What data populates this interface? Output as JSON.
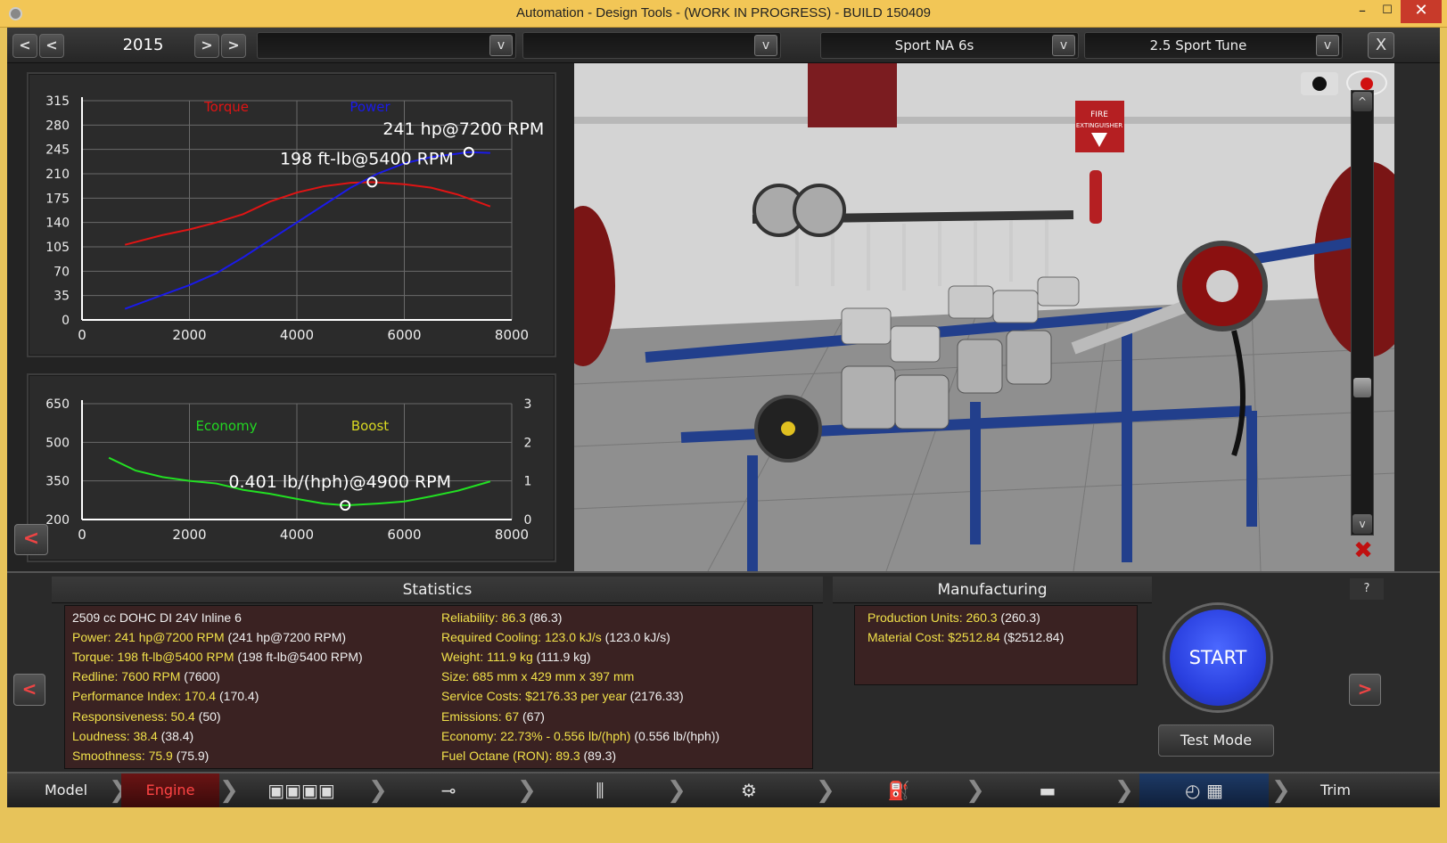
{
  "window": {
    "title": "Automation - Design Tools - (WORK IN PROGRESS) - BUILD 150409",
    "min": "–",
    "max": "☐",
    "close": "✕"
  },
  "toolbar": {
    "year": "2015",
    "prev_fast": "<",
    "prev": "<",
    "next": ">",
    "next_fast": ">",
    "dropdown1": "",
    "dropdown2": "",
    "dropdown3": "Sport NA 6s",
    "dropdown4": "2.5 Sport Tune",
    "arrow": "v",
    "close": "X"
  },
  "charts": {
    "power_torque": {
      "type": "line",
      "x_ticks": [
        "0",
        "2000",
        "4000",
        "6000",
        "8000"
      ],
      "y_ticks": [
        "315",
        "280",
        "245",
        "210",
        "175",
        "140",
        "105",
        "70",
        "35",
        "0"
      ],
      "xlim": [
        0,
        8000
      ],
      "ylim": [
        0,
        315
      ],
      "legend": [
        "Torque",
        "Power"
      ],
      "series": [
        {
          "name": "Torque",
          "color": "#e01414",
          "x": [
            800,
            1500,
            2000,
            2500,
            3000,
            3500,
            4000,
            4500,
            5000,
            5400,
            6000,
            6500,
            7000,
            7600
          ],
          "y": [
            108,
            122,
            130,
            140,
            152,
            170,
            183,
            192,
            197,
            198,
            195,
            190,
            180,
            163
          ]
        },
        {
          "name": "Power",
          "color": "#1a1ae8",
          "x": [
            800,
            1500,
            2000,
            2500,
            3000,
            3500,
            4000,
            4500,
            5000,
            5500,
            6000,
            6500,
            7200,
            7600
          ],
          "y": [
            16,
            36,
            50,
            67,
            90,
            115,
            140,
            165,
            190,
            210,
            225,
            234,
            241,
            240
          ]
        }
      ],
      "annotations": [
        {
          "text": "241 hp@7200 RPM",
          "x": 7200,
          "y": 241
        },
        {
          "text": "198 ft-lb@5400 RPM",
          "x": 5400,
          "y": 198
        }
      ]
    },
    "economy": {
      "type": "line",
      "x_ticks": [
        "0",
        "2000",
        "4000",
        "6000",
        "8000"
      ],
      "y_ticks": [
        "650",
        "500",
        "350",
        "200"
      ],
      "y2_ticks": [
        "3",
        "2",
        "1",
        "0"
      ],
      "xlim": [
        0,
        8000
      ],
      "ylim": [
        200,
        650
      ],
      "legend": [
        "Economy",
        "Boost"
      ],
      "legend_colors": [
        "#22d822",
        "#d8d822"
      ],
      "series": [
        {
          "name": "Economy",
          "color": "#22e022",
          "x": [
            500,
            1000,
            1500,
            2000,
            2500,
            3000,
            3500,
            4000,
            4500,
            4900,
            5500,
            6000,
            6500,
            7000,
            7600
          ],
          "y": [
            440,
            390,
            365,
            350,
            340,
            315,
            300,
            280,
            262,
            255,
            262,
            270,
            290,
            312,
            348
          ]
        }
      ],
      "annotations": [
        {
          "text": "0.401 lb/(hph)@4900 RPM",
          "x": 4900,
          "y": 255
        }
      ]
    }
  },
  "collapse_label": "<",
  "viewport": {
    "sign_text": "FIRE\nEXTINGUISHER",
    "scroll_up": "^",
    "scroll_down": "v"
  },
  "statistics": {
    "title": "Statistics",
    "left": [
      {
        "key": "2509 cc DOHC DI 24V Inline 6",
        "paren": "",
        "white": true
      },
      {
        "key": "Power: 241 hp@7200 RPM",
        "paren": "(241 hp@7200 RPM)"
      },
      {
        "key": "Torque: 198 ft-lb@5400 RPM",
        "paren": "(198 ft-lb@5400 RPM)"
      },
      {
        "key": "Redline: 7600 RPM",
        "paren": "(7600)"
      },
      {
        "key": "Performance Index: 170.4",
        "paren": "(170.4)"
      },
      {
        "key": "Responsiveness: 50.4",
        "paren": "(50)"
      },
      {
        "key": "Loudness: 38.4",
        "paren": "(38.4)"
      },
      {
        "key": "Smoothness: 75.9",
        "paren": "(75.9)"
      }
    ],
    "right": [
      {
        "key": "Reliability: 86.3",
        "paren": "(86.3)"
      },
      {
        "key": "Required Cooling: 123.0 kJ/s",
        "paren": "(123.0 kJ/s)"
      },
      {
        "key": "Weight: 111.9 kg",
        "paren": "(111.9 kg)"
      },
      {
        "key": "Size: 685 mm x 429 mm x 397 mm",
        "paren": ""
      },
      {
        "key": "Service Costs: $2176.33 per year",
        "paren": "(2176.33)"
      },
      {
        "key": "Emissions: 67",
        "paren": "(67)"
      },
      {
        "key": "Economy: 22.73% - 0.556 lb/(hph)",
        "paren": "(0.556 lb/(hph))"
      },
      {
        "key": "Fuel Octane (RON): 89.3",
        "paren": "(89.3)"
      }
    ]
  },
  "manufacturing": {
    "title": "Manufacturing",
    "rows": [
      {
        "key": "Production Units: 260.3",
        "paren": "(260.3)"
      },
      {
        "key": "Material Cost: $2512.84",
        "paren": "($2512.84)"
      }
    ]
  },
  "actions": {
    "start": "START",
    "test_mode": "Test Mode",
    "help": "?",
    "left_arrow": "<",
    "right_arrow": ">"
  },
  "nav": {
    "model": "Model",
    "engine": "Engine",
    "trim": "Trim",
    "sep": "❯"
  }
}
